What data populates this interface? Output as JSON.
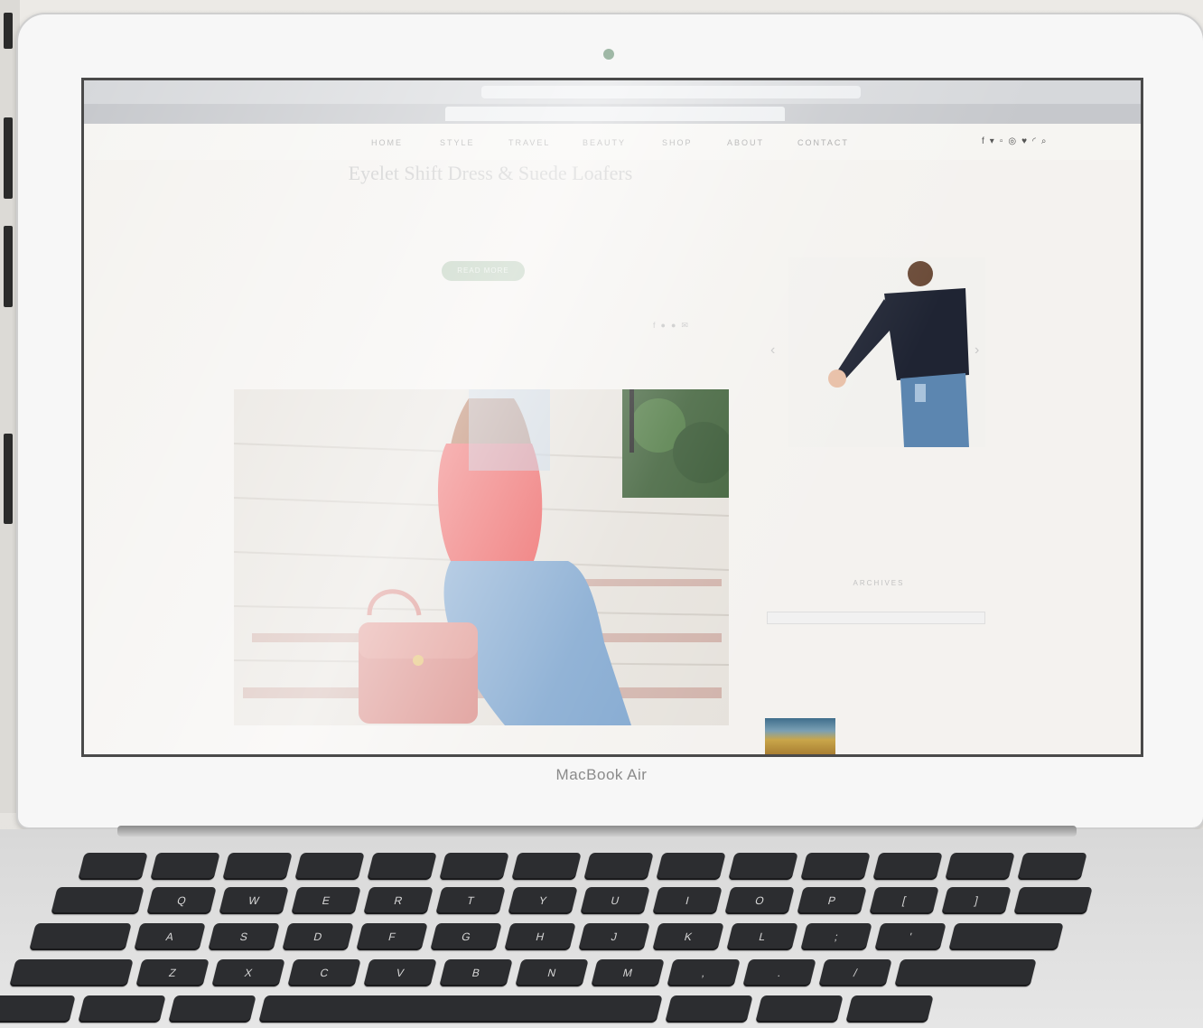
{
  "device": {
    "brand_label": "MacBook Air"
  },
  "browser": {
    "url": "",
    "tabs": [
      {
        "label": "",
        "active": false
      },
      {
        "label": "",
        "active": true
      },
      {
        "label": "",
        "active": false
      }
    ]
  },
  "site": {
    "logo": "",
    "nav": [
      "HOME",
      "STYLE",
      "TRAVEL",
      "BEAUTY",
      "SHOP",
      "ABOUT",
      "CONTACT"
    ],
    "social_icons": [
      "facebook-icon",
      "twitter-icon",
      "instagram-icon",
      "pinterest-icon",
      "heart-icon",
      "rss-icon",
      "search-icon"
    ]
  },
  "post": {
    "title": "Eyelet Shift Dress & Suede Loafers",
    "excerpt": "",
    "read_more": "READ MORE"
  },
  "sidebar": {
    "archives_title": "ARCHIVES",
    "archives_select": "",
    "popular_title": "",
    "popular_item": ""
  },
  "keyboard": {
    "row1": [
      "",
      "",
      "",
      "",
      "",
      "",
      "",
      "",
      "",
      "",
      "",
      "",
      "",
      ""
    ],
    "row2": [
      "",
      "Q",
      "W",
      "E",
      "R",
      "T",
      "Y",
      "U",
      "I",
      "O",
      "P",
      "[",
      "]",
      ""
    ],
    "row3": [
      "",
      "A",
      "S",
      "D",
      "F",
      "G",
      "H",
      "J",
      "K",
      "L",
      ";",
      "'",
      ""
    ],
    "row4": [
      "",
      "Z",
      "X",
      "C",
      "V",
      "B",
      "N",
      "M",
      ",",
      ".",
      "/",
      ""
    ],
    "row5": [
      "",
      "",
      "",
      "",
      "",
      "",
      ""
    ]
  }
}
